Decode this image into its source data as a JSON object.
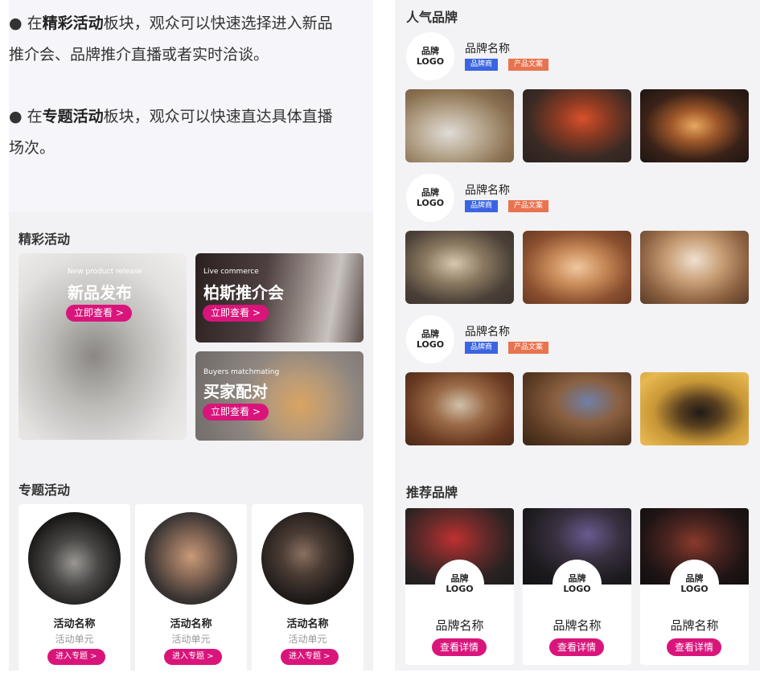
{
  "intro": {
    "p1": {
      "bullet": "●",
      "pre": "在",
      "bold": "精彩活动",
      "rest": "板块，观众可以快速选择进入新品",
      "line2": "推介会、品牌推介直播或者实时洽谈。"
    },
    "p2": {
      "bullet": "●",
      "pre": "在",
      "bold": "专题活动",
      "rest": "板块，观众可以快速直达具体直播",
      "line2": "场次。"
    }
  },
  "highlights": {
    "title": "精彩活动",
    "cards": [
      {
        "en": "New product release",
        "cn": "新品发布",
        "cta": "立即查看 >"
      },
      {
        "en": "Live commerce",
        "cn": "柏斯推介会",
        "cta": "立即查看 >"
      },
      {
        "en": "Buyers matchmating",
        "cn": "买家配对",
        "cta": "立即查看 >"
      }
    ]
  },
  "topics": {
    "title": "专题活动",
    "items": [
      {
        "name": "活动名称",
        "unit": "活动单元",
        "cta": "进入专题 >"
      },
      {
        "name": "活动名称",
        "unit": "活动单元",
        "cta": "进入专题 >"
      },
      {
        "name": "活动名称",
        "unit": "活动单元",
        "cta": "进入专题 >"
      }
    ]
  },
  "popular": {
    "title": "人气品牌",
    "brands": [
      {
        "logo1": "品牌",
        "logo2": "LOGO",
        "name": "品牌名称",
        "tag1": "品牌商",
        "tag2": "产品文案"
      },
      {
        "logo1": "品牌",
        "logo2": "LOGO",
        "name": "品牌名称",
        "tag1": "品牌商",
        "tag2": "产品文案"
      },
      {
        "logo1": "品牌",
        "logo2": "LOGO",
        "name": "品牌名称",
        "tag1": "品牌商",
        "tag2": "产品文案"
      }
    ]
  },
  "recommended": {
    "title": "推荐品牌",
    "items": [
      {
        "logo1": "品牌",
        "logo2": "LOGO",
        "name": "品牌名称",
        "cta": "查看详情"
      },
      {
        "logo1": "品牌",
        "logo2": "LOGO",
        "name": "品牌名称",
        "cta": "查看详情"
      },
      {
        "logo1": "品牌",
        "logo2": "LOGO",
        "name": "品牌名称",
        "cta": "查看详情"
      }
    ]
  },
  "colors": {
    "accent": "#d9157b",
    "tag_blue": "#3a64e0",
    "tag_orange": "#e8734f"
  }
}
